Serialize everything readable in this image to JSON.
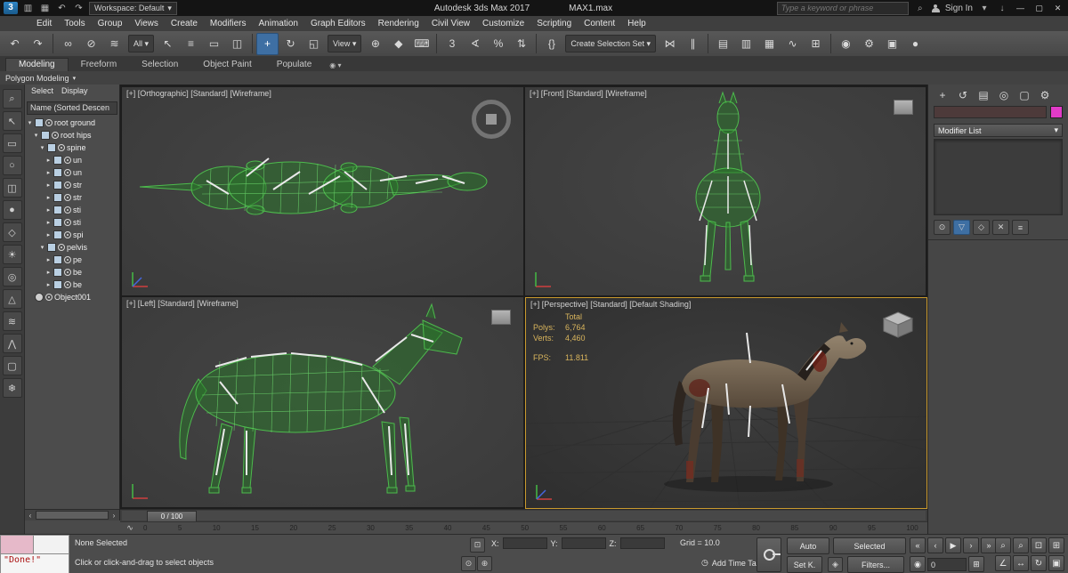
{
  "titlebar": {
    "title": "Autodesk 3ds Max 2017",
    "filename": "MAX1.max",
    "workspace_label": "Workspace: Default",
    "search_placeholder": "Type a keyword or phrase",
    "sign_in": "Sign In"
  },
  "menubar": {
    "items": [
      "Edit",
      "Tools",
      "Group",
      "Views",
      "Create",
      "Modifiers",
      "Animation",
      "Graph Editors",
      "Rendering",
      "Civil View",
      "Customize",
      "Scripting",
      "Content",
      "Help"
    ]
  },
  "toolbar": {
    "items": [
      {
        "name": "undo-icon",
        "glyph": "↶",
        "cls": "tb-icon"
      },
      {
        "name": "redo-icon",
        "glyph": "↷",
        "cls": "tb-icon"
      },
      {
        "name": "toolbar-separator",
        "glyph": "",
        "cls": "tb-sep"
      },
      {
        "name": "select-and-link-icon",
        "glyph": "∞",
        "cls": "tb-icon"
      },
      {
        "name": "unlink-selection-icon",
        "glyph": "⊘",
        "cls": "tb-icon"
      },
      {
        "name": "bind-to-spacewarp-icon",
        "glyph": "≋",
        "cls": "tb-icon"
      },
      {
        "name": "selection-filter-dropdown",
        "glyph": "All ▾",
        "cls": "tb-drop"
      },
      {
        "name": "select-object-icon",
        "glyph": "↖",
        "cls": "tb-icon"
      },
      {
        "name": "select-by-name-icon",
        "glyph": "≡",
        "cls": "tb-icon"
      },
      {
        "name": "rectangular-selection-icon",
        "glyph": "▭",
        "cls": "tb-icon"
      },
      {
        "name": "window-crossing-icon",
        "glyph": "◫",
        "cls": "tb-icon"
      },
      {
        "name": "toolbar-separator",
        "glyph": "",
        "cls": "tb-sep"
      },
      {
        "name": "select-and-move-icon",
        "glyph": "+",
        "cls": "tb-icon active"
      },
      {
        "name": "select-and-rotate-icon",
        "glyph": "↻",
        "cls": "tb-icon"
      },
      {
        "name": "select-and-scale-icon",
        "glyph": "◱",
        "cls": "tb-icon"
      },
      {
        "name": "reference-coordinate-dropdown",
        "glyph": "View ▾",
        "cls": "tb-drop"
      },
      {
        "name": "use-pivot-center-icon",
        "glyph": "⊕",
        "cls": "tb-icon"
      },
      {
        "name": "select-and-manipulate-icon",
        "glyph": "◆",
        "cls": "tb-icon"
      },
      {
        "name": "keyboard-override-icon",
        "glyph": "⌨",
        "cls": "tb-icon"
      },
      {
        "name": "toolbar-separator",
        "glyph": "",
        "cls": "tb-sep"
      },
      {
        "name": "snaps-toggle-icon",
        "glyph": "3",
        "cls": "tb-icon"
      },
      {
        "name": "angle-snap-icon",
        "glyph": "∢",
        "cls": "tb-icon"
      },
      {
        "name": "percent-snap-icon",
        "glyph": "%",
        "cls": "tb-icon"
      },
      {
        "name": "spinner-snap-icon",
        "glyph": "⇅",
        "cls": "tb-icon"
      },
      {
        "name": "toolbar-separator",
        "glyph": "",
        "cls": "tb-sep"
      },
      {
        "name": "named-selection-sets-icon",
        "glyph": "{}",
        "cls": "tb-icon"
      },
      {
        "name": "selection-set-dropdown",
        "glyph": "Create Selection Set ▾",
        "cls": "tb-drop"
      },
      {
        "name": "mirror-icon",
        "glyph": "⋈",
        "cls": "tb-icon"
      },
      {
        "name": "align-icon",
        "glyph": "∥",
        "cls": "tb-icon"
      },
      {
        "name": "toolbar-separator",
        "glyph": "",
        "cls": "tb-sep"
      },
      {
        "name": "layer-manager-icon",
        "glyph": "▤",
        "cls": "tb-icon"
      },
      {
        "name": "scene-explorer-toggle-icon",
        "glyph": "▥",
        "cls": "tb-icon"
      },
      {
        "name": "ribbon-toggle-icon",
        "glyph": "▦",
        "cls": "tb-icon"
      },
      {
        "name": "curve-editor-icon",
        "glyph": "∿",
        "cls": "tb-icon"
      },
      {
        "name": "schematic-view-icon",
        "glyph": "⊞",
        "cls": "tb-icon"
      },
      {
        "name": "toolbar-separator",
        "glyph": "",
        "cls": "tb-sep"
      },
      {
        "name": "material-editor-icon",
        "glyph": "◉",
        "cls": "tb-icon"
      },
      {
        "name": "render-setup-icon",
        "glyph": "⚙",
        "cls": "tb-icon"
      },
      {
        "name": "rendered-frame-icon",
        "glyph": "▣",
        "cls": "tb-icon"
      },
      {
        "name": "render-production-icon",
        "glyph": "●",
        "cls": "tb-icon"
      }
    ]
  },
  "ribbon": {
    "tabs": [
      {
        "label": "Modeling",
        "cls": "rtab active"
      },
      {
        "label": "Freeform",
        "cls": "rtab"
      },
      {
        "label": "Selection",
        "cls": "rtab"
      },
      {
        "label": "Object Paint",
        "cls": "rtab"
      },
      {
        "label": "Populate",
        "cls": "rtab"
      }
    ],
    "panel_title": "Polygon Modeling"
  },
  "explorer": {
    "menus": [
      "Select",
      "Display"
    ],
    "header": "Name (Sorted Descen",
    "toolbar": [
      {
        "name": "explorer-find-icon",
        "glyph": "⌕"
      },
      {
        "name": "select-object-filter-icon",
        "glyph": "↖"
      },
      {
        "name": "rect-region-filter-icon",
        "glyph": "▭"
      },
      {
        "name": "lasso-region-filter-icon",
        "glyph": "○"
      },
      {
        "name": "window-crossing-filter-icon",
        "glyph": "◫"
      },
      {
        "name": "geometry-filter-icon",
        "glyph": "●"
      },
      {
        "name": "shapes-filter-icon",
        "glyph": "◇"
      },
      {
        "name": "lights-filter-icon",
        "glyph": "☀"
      },
      {
        "name": "cameras-filter-icon",
        "glyph": "◎"
      },
      {
        "name": "helpers-filter-icon",
        "glyph": "△"
      },
      {
        "name": "spacewarps-filter-icon",
        "glyph": "≋"
      },
      {
        "name": "bones-filter-icon",
        "glyph": "⋀"
      },
      {
        "name": "containers-filter-icon",
        "glyph": "▢"
      },
      {
        "name": "frozen-filter-icon",
        "glyph": "❄"
      }
    ],
    "items": [
      {
        "indent": 0,
        "arrow": "▾",
        "label": "root ground",
        "kind": "tree-type"
      },
      {
        "indent": 1,
        "arrow": "▾",
        "label": "root hips",
        "kind": "tree-type"
      },
      {
        "indent": 2,
        "arrow": "▾",
        "label": "spine",
        "kind": "tree-type"
      },
      {
        "indent": 3,
        "arrow": "▸",
        "label": "un",
        "kind": "tree-type"
      },
      {
        "indent": 3,
        "arrow": "▸",
        "label": "un",
        "kind": "tree-type"
      },
      {
        "indent": 3,
        "arrow": "▸",
        "label": "str",
        "kind": "tree-type"
      },
      {
        "indent": 3,
        "arrow": "▸",
        "label": "str",
        "kind": "tree-type"
      },
      {
        "indent": 3,
        "arrow": "▸",
        "label": "sti",
        "kind": "tree-type"
      },
      {
        "indent": 3,
        "arrow": "▸",
        "label": "sti",
        "kind": "tree-type"
      },
      {
        "indent": 3,
        "arrow": "▸",
        "label": "spi",
        "kind": "tree-type"
      },
      {
        "indent": 2,
        "arrow": "▾",
        "label": "pelvis",
        "kind": "tree-type"
      },
      {
        "indent": 3,
        "arrow": "▸",
        "label": "pe",
        "kind": "tree-type"
      },
      {
        "indent": 3,
        "arrow": "▸",
        "label": "be",
        "kind": "tree-type"
      },
      {
        "indent": 3,
        "arrow": "▸",
        "label": "be",
        "kind": "tree-type"
      },
      {
        "indent": 0,
        "arrow": "",
        "label": "Object001",
        "kind": "tree-type object"
      }
    ]
  },
  "viewports": {
    "top_left_label": "[+] [Orthographic] [Standard] [Wireframe]",
    "top_right_label": "[+] [Front] [Standard] [Wireframe]",
    "bottom_left_label": "[+] [Left] [Standard] [Wireframe]",
    "perspective_label": "[+] [Perspective] [Standard] [Default Shading]",
    "stats": {
      "total_label": "Total",
      "polys_label": "Polys:",
      "polys_value": "6,764",
      "verts_label": "Verts:",
      "verts_value": "4,460",
      "fps_label": "FPS:",
      "fps_value": "11.811"
    }
  },
  "timeline": {
    "slider_label": "0 / 100",
    "ticks": [
      "0",
      "5",
      "10",
      "15",
      "20",
      "25",
      "30",
      "35",
      "40",
      "45",
      "50",
      "55",
      "60",
      "65",
      "70",
      "75",
      "80",
      "85",
      "90",
      "95",
      "100"
    ]
  },
  "statusbar": {
    "listener_output": "\"Done!\"",
    "selection_line": "None Selected",
    "prompt_line": "Click or click-and-drag to select objects",
    "x_label": "X:",
    "y_label": "Y:",
    "z_label": "Z:",
    "grid_text": "Grid = 10.0",
    "time_tag": "Add Time Tag",
    "auto_label": "Auto",
    "selected_label": "Selected",
    "set_key_label": "Set K.",
    "filters_label": "Filters...",
    "frame_value": "0"
  },
  "cpanel": {
    "tabs": [
      {
        "name": "create-tab-icon",
        "glyph": "+"
      },
      {
        "name": "modify-tab-icon",
        "glyph": "↺"
      },
      {
        "name": "hierarchy-tab-icon",
        "glyph": "▤"
      },
      {
        "name": "motion-tab-icon",
        "glyph": "◎"
      },
      {
        "name": "display-tab-icon",
        "glyph": "▢"
      },
      {
        "name": "utilities-tab-icon",
        "glyph": "⚙"
      }
    ],
    "modifier_list_label": "Modifier List",
    "stack_buttons": [
      {
        "name": "pin-stack-icon",
        "glyph": "⊙",
        "cls": "cp-sbtn"
      },
      {
        "name": "show-end-result-icon",
        "glyph": "▽",
        "cls": "cp-sbtn active"
      },
      {
        "name": "make-unique-icon",
        "glyph": "◇",
        "cls": "cp-sbtn"
      },
      {
        "name": "remove-modifier-icon",
        "glyph": "✕",
        "cls": "cp-sbtn"
      },
      {
        "name": "configure-stack-icon",
        "glyph": "≡",
        "cls": "cp-sbtn"
      }
    ]
  },
  "playback": {
    "buttons": [
      {
        "name": "go-to-start-button",
        "glyph": "«"
      },
      {
        "name": "previous-frame-button",
        "glyph": "‹"
      },
      {
        "name": "play-button",
        "glyph": "▶"
      },
      {
        "name": "next-frame-button",
        "glyph": "›"
      },
      {
        "name": "go-to-end-button",
        "glyph": "»"
      }
    ],
    "time_config_glyph": "⊞",
    "key_mode_glyph": "◉"
  },
  "nav": {
    "buttons": [
      {
        "name": "zoom-icon",
        "glyph": "⌕"
      },
      {
        "name": "zoom-all-icon",
        "glyph": "⌕"
      },
      {
        "name": "zoom-extents-icon",
        "glyph": "⊡"
      },
      {
        "name": "zoom-extents-all-icon",
        "glyph": "⊞"
      },
      {
        "name": "fov-icon",
        "glyph": "∠"
      },
      {
        "name": "pan-icon",
        "glyph": "↔"
      },
      {
        "name": "orbit-icon",
        "glyph": "↻"
      },
      {
        "name": "maximize-viewport-icon",
        "glyph": "▣"
      }
    ]
  },
  "icons": {
    "app_logo": "3",
    "open": "▥",
    "save": "▦",
    "undo": "↶",
    "redo": "↷",
    "caret": "▾",
    "search": "⌕",
    "download": "↓",
    "minimize": "—",
    "maximize": "▢",
    "close": "✕",
    "clock": "◷",
    "mini_curve": "∿",
    "lock": "⊡",
    "isolate": "⊙",
    "offset_mode": "⊕",
    "key_filter": "◈",
    "scroll_left": "‹",
    "scroll_right": "›"
  },
  "colors": {
    "wireframe_green": "#4dbb4d",
    "active_viewport_border": "#c99a2e",
    "object_color_swatch": "#e23bc8",
    "stats_text": "#d8b45c"
  }
}
